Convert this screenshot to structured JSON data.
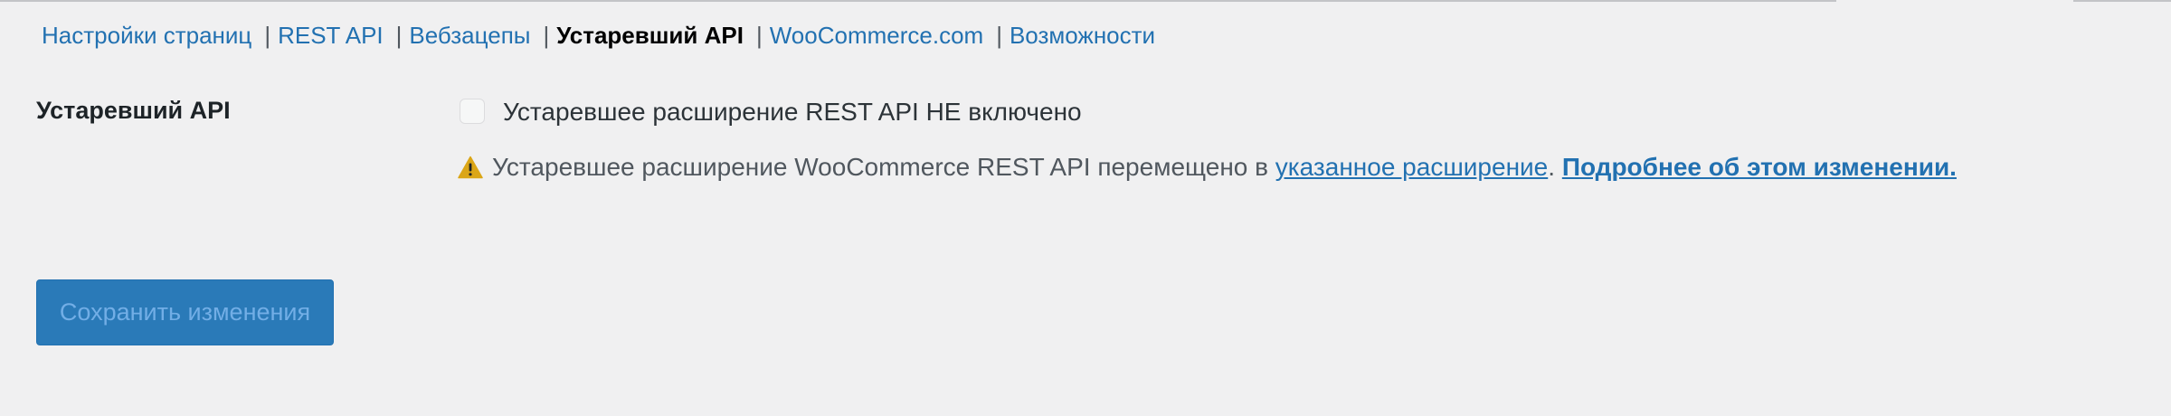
{
  "subnav": {
    "items": [
      {
        "label": "Настройки страниц"
      },
      {
        "label": "REST API"
      },
      {
        "label": "Вебзацепы"
      },
      {
        "label": "Устаревший API"
      },
      {
        "label": "WooCommerce.com"
      },
      {
        "label": "Возможности"
      }
    ],
    "separator": "|",
    "current_index": 3
  },
  "setting": {
    "label": "Устаревший API",
    "checkbox_checked": false,
    "checkbox_label": "Устаревшее расширение REST API НЕ включено"
  },
  "notice": {
    "icon": "warning-icon",
    "text_before": "Устаревшее расширение WooCommerce REST API перемещено в",
    "link_extension": "указанное расширение",
    "text_period": ".",
    "link_more": "Подробнее об этом изменении."
  },
  "save_button": {
    "label": "Сохранить изменения",
    "disabled": true
  },
  "colors": {
    "background": "#f0f0f1",
    "link": "#2271b1",
    "button_bg": "#2a7ab8",
    "button_text_disabled": "#72aee6",
    "warning": "#dba617"
  }
}
